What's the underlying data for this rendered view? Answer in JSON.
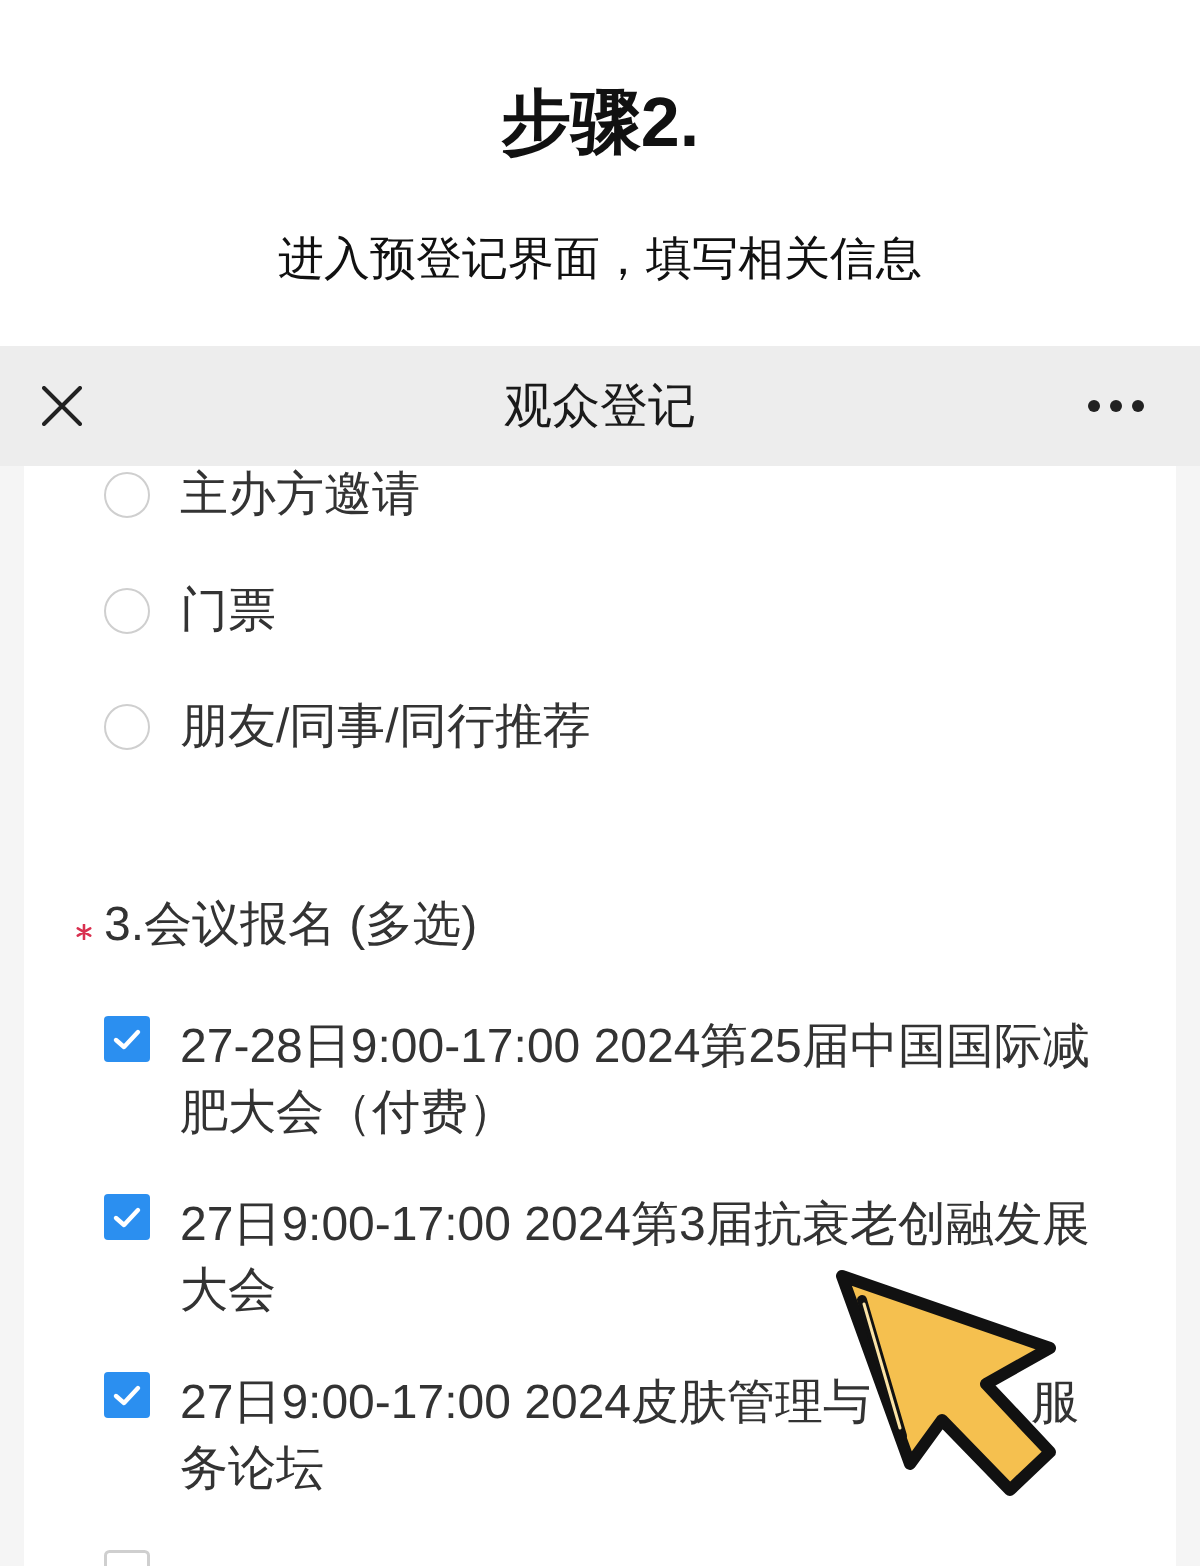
{
  "title": "步骤2.",
  "subtitle": "进入预登记界面，填写相关信息",
  "webview": {
    "title": "观众登记"
  },
  "questions": [
    {
      "kind": "radio",
      "options": [
        {
          "label": "主办方邀请",
          "selected": false
        },
        {
          "label": "门票",
          "selected": false
        },
        {
          "label": "朋友/同事/同行推荐",
          "selected": false
        }
      ]
    },
    {
      "kind": "checkbox",
      "required": true,
      "title": "3.会议报名 (多选)",
      "options": [
        {
          "label": "27-28日9:00-17:00 2024第25届中国国际减肥大会（付费）",
          "checked": true
        },
        {
          "label": "27日9:00-17:00 2024第3届抗衰老创融发展大会",
          "checked": true
        },
        {
          "label_lines": [
            [
              "27日9:00-17:00 2024皮肤管理与",
              "服"
            ],
            [
              "务论坛"
            ]
          ],
          "checked": true
        },
        {
          "checked": false
        }
      ]
    }
  ]
}
